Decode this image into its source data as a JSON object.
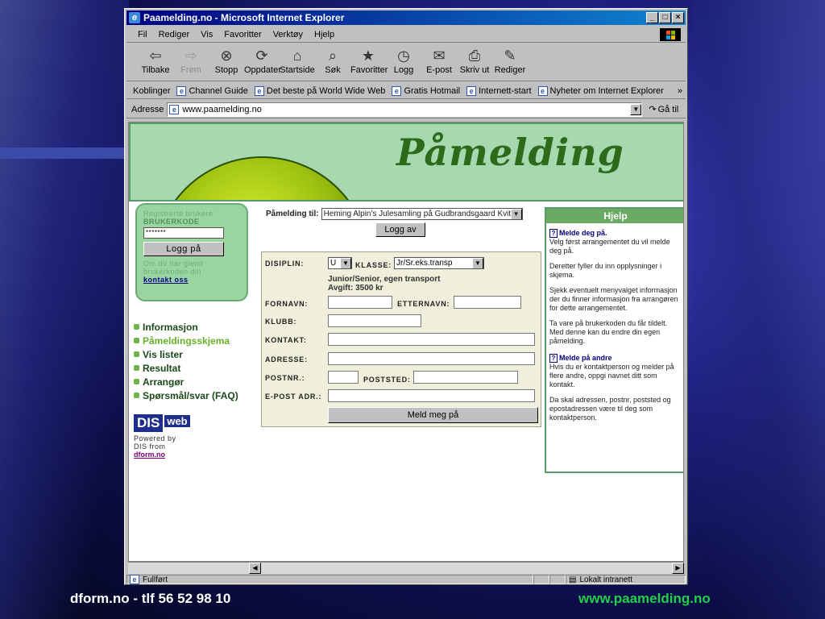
{
  "footer": {
    "left": "dform.no - tlf  56 52 98 10",
    "right": "www.paamelding.no"
  },
  "window": {
    "title": "Paamelding.no - Microsoft Internet Explorer",
    "controls": [
      "_",
      "□",
      "×"
    ]
  },
  "menu": [
    "Fil",
    "Rediger",
    "Vis",
    "Favoritter",
    "Verktøy",
    "Hjelp"
  ],
  "toolbar": [
    {
      "label": "Tilbake",
      "icon": "back-arrow-icon",
      "glyph": "⇦",
      "enabled": true
    },
    {
      "label": "Frem",
      "icon": "forward-arrow-icon",
      "glyph": "⇨",
      "enabled": false
    },
    {
      "label": "Stopp",
      "icon": "stop-icon",
      "glyph": "⊗",
      "enabled": true
    },
    {
      "label": "Oppdater",
      "icon": "refresh-icon",
      "glyph": "⟳",
      "enabled": true
    },
    {
      "label": "Startside",
      "icon": "home-icon",
      "glyph": "⌂",
      "enabled": true
    },
    {
      "label": "Søk",
      "icon": "search-icon",
      "glyph": "⌕",
      "enabled": true
    },
    {
      "label": "Favoritter",
      "icon": "favorites-icon",
      "glyph": "★",
      "enabled": true
    },
    {
      "label": "Logg",
      "icon": "history-icon",
      "glyph": "◷",
      "enabled": true
    },
    {
      "label": "E-post",
      "icon": "mail-icon",
      "glyph": "✉",
      "enabled": true
    },
    {
      "label": "Skriv ut",
      "icon": "print-icon",
      "glyph": "⎙",
      "enabled": true
    },
    {
      "label": "Rediger",
      "icon": "edit-icon",
      "glyph": "✎",
      "enabled": true
    }
  ],
  "links": {
    "label": "Koblinger",
    "items": [
      "Channel Guide",
      "Det beste på World Wide Web",
      "Gratis Hotmail",
      "Internett-start",
      "Nyheter om Internet Explorer"
    ],
    "more": "»"
  },
  "address": {
    "label": "Adresse",
    "value": "www.paamelding.no",
    "go": "Gå til"
  },
  "page": {
    "banner_title": "Påmelding",
    "login": {
      "line1": "Registrerte brukere:",
      "line2": "BRUKERKODE",
      "password": "*******",
      "button": "Logg på",
      "help1": "Om du har glemt",
      "help2": "brukerkoden din",
      "contact": "kontakt oss"
    },
    "nav": [
      "Informasjon",
      "Påmeldingsskjema",
      "Vis lister",
      "Resultat",
      "Arrangør",
      "Spørsmål/svar (FAQ)"
    ],
    "dis": {
      "dis": "DIS",
      "web": "web",
      "powered": "Powered by",
      "from": "DIS from",
      "link": "dform.no"
    },
    "registration": {
      "label": "Påmelding til:",
      "event": "Heming Alpin's Julesamling på Gudbrandsgaard Kvitfjell",
      "logout": "Logg av"
    },
    "form": {
      "discipline_label": "DISIPLIN:",
      "discipline_value": "U",
      "class_label": "KLASSE:",
      "class_value": "Jr/Sr.eks.transp",
      "note1": "Junior/Senior, egen transport",
      "note2": "Avgift: 3500 kr",
      "firstname": "FORNAVN:",
      "lastname": "ETTERNAVN:",
      "club": "KLUBB:",
      "contact": "KONTAKT:",
      "address": "ADRESSE:",
      "zip": "POSTNR.:",
      "city": "POSTSTED:",
      "email": "E-POST ADR.:",
      "submit": "Meld meg på"
    },
    "help": {
      "title": "Hjelp",
      "h1": "Melde deg på.",
      "p1": "Velg først arrangementet du vil melde deg på.",
      "p2": "Deretter fyller du inn opplysninger i skjema.",
      "p3": "Sjekk eventuelt menyvalget informasjon der du finner informasjon fra arrangøren for dette arrangementet.",
      "p4": "Ta vare på brukerkoden du får tildelt. Med denne kan du endre din egen påmelding.",
      "h2": "Melde på andre",
      "p5": "Hvis du er kontaktperson og melder på flere andre, oppgi navnet ditt som kontakt.",
      "p6": "Da skal adressen, postnr, poststed og epostadressen være til deg som kontaktperson."
    }
  },
  "status": {
    "left": "Fullført",
    "zone": "Lokalt intranett"
  }
}
